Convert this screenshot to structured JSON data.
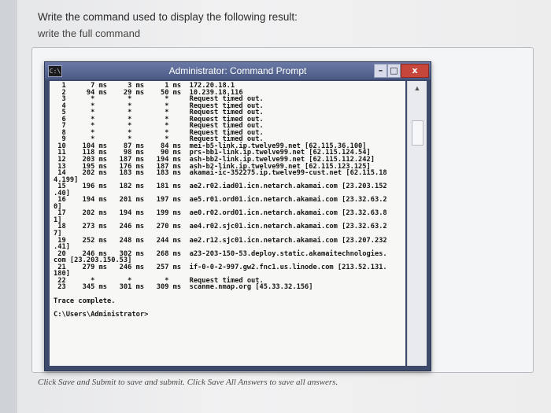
{
  "question": {
    "text": "Write the command used to display the following result:",
    "instruction": "write the full command"
  },
  "window": {
    "title": "Administrator: Command Prompt",
    "icon_label": "C:\\",
    "buttons": {
      "minimize": "–",
      "maximize": "□",
      "close": "x"
    },
    "scrollbar": {
      "up_arrow": "▲"
    }
  },
  "console_lines": [
    "  1      7 ms     3 ms     1 ms  172.20.18.1",
    "  2     94 ms    29 ms    50 ms  10.239.18.116",
    "  3      *        *        *     Request timed out.",
    "  4      *        *        *     Request timed out.",
    "  5      *        *        *     Request timed out.",
    "  6      *        *        *     Request timed out.",
    "  7      *        *        *     Request timed out.",
    "  8      *        *        *     Request timed out.",
    "  9      *        *        *     Request timed out.",
    " 10    104 ms    87 ms    84 ms  mei-b5-link.ip.twelve99.net [62.115.36.100]",
    " 11    118 ms    98 ms    90 ms  prs-bb1-link.ip.twelve99.net [62.115.124.54]",
    " 12    203 ms   187 ms   194 ms  ash-bb2-link.ip.twelve99.net [62.115.112.242]",
    " 13    195 ms   176 ms   187 ms  ash-b2-link.ip.twelve99.net [62.115.123.125]",
    " 14    202 ms   183 ms   183 ms  akamai-ic-352275.ip.twelve99-cust.net [62.115.18",
    "4.199]",
    " 15    196 ms   182 ms   181 ms  ae2.r02.iad01.icn.netarch.akamai.com [23.203.152",
    ".40]",
    " 16    194 ms   201 ms   197 ms  ae5.r01.ord01.icn.netarch.akamai.com [23.32.63.2",
    "0]",
    " 17    202 ms   194 ms   199 ms  ae0.r02.ord01.icn.netarch.akamai.com [23.32.63.8",
    "1]",
    " 18    273 ms   246 ms   270 ms  ae4.r02.sjc01.icn.netarch.akamai.com [23.32.63.2",
    "7]",
    " 19    252 ms   248 ms   244 ms  ae2.r12.sjc01.icn.netarch.akamai.com [23.207.232",
    ".41]",
    " 20    246 ms   302 ms   268 ms  a23-203-150-53.deploy.static.akamaitechnologies.",
    "com [23.203.150.53]",
    " 21    279 ms   246 ms   257 ms  if-0-0-2-997.gw2.fnc1.us.linode.com [213.52.131.",
    "180]",
    " 22      *        *        *     Request timed out.",
    " 23    345 ms   301 ms   309 ms  scanme.nmap.org [45.33.32.156]",
    "",
    "Trace complete.",
    "",
    "C:\\Users\\Administrator>"
  ],
  "footer": "Click Save and Submit to save and submit. Click Save All Answers to save all answers."
}
